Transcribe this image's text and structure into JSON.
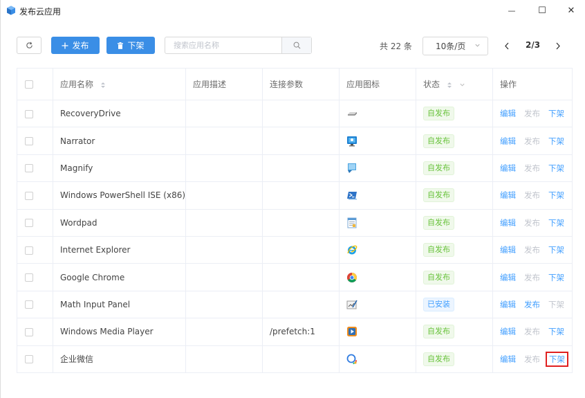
{
  "window": {
    "title": "发布云应用",
    "minimize_glyph": "—",
    "maximize_glyph": "☐",
    "close_glyph": "✕"
  },
  "toolbar": {
    "publish_label": "发布",
    "unpublish_label": "下架",
    "search_placeholder": "搜索应用名称",
    "total_text": "共 22 条",
    "page_size": "10条/页",
    "page_info": "2/3"
  },
  "table": {
    "headers": {
      "name": "应用名称",
      "desc": "应用描述",
      "params": "连接参数",
      "icon": "应用图标",
      "status": "状态",
      "ops": "操作"
    },
    "rows": [
      {
        "name": "RecoveryDrive",
        "desc": "",
        "params": "",
        "icon": "drive-icon",
        "status": "自发布",
        "status_type": "green",
        "edit": "编辑",
        "publish": "发布",
        "publish_enabled": false,
        "unpublish": "下架",
        "unpublish_enabled": true
      },
      {
        "name": "Narrator",
        "desc": "",
        "params": "",
        "icon": "narrator-icon",
        "status": "自发布",
        "status_type": "green",
        "edit": "编辑",
        "publish": "发布",
        "publish_enabled": false,
        "unpublish": "下架",
        "unpublish_enabled": true
      },
      {
        "name": "Magnify",
        "desc": "",
        "params": "",
        "icon": "magnify-icon",
        "status": "自发布",
        "status_type": "green",
        "edit": "编辑",
        "publish": "发布",
        "publish_enabled": false,
        "unpublish": "下架",
        "unpublish_enabled": true
      },
      {
        "name": "Windows PowerShell ISE (x86)",
        "desc": "",
        "params": "",
        "icon": "powershell-icon",
        "status": "自发布",
        "status_type": "green",
        "edit": "编辑",
        "publish": "发布",
        "publish_enabled": false,
        "unpublish": "下架",
        "unpublish_enabled": true
      },
      {
        "name": "Wordpad",
        "desc": "",
        "params": "",
        "icon": "wordpad-icon",
        "status": "自发布",
        "status_type": "green",
        "edit": "编辑",
        "publish": "发布",
        "publish_enabled": false,
        "unpublish": "下架",
        "unpublish_enabled": true
      },
      {
        "name": "Internet Explorer",
        "desc": "",
        "params": "",
        "icon": "internet-explorer-icon",
        "status": "自发布",
        "status_type": "green",
        "edit": "编辑",
        "publish": "发布",
        "publish_enabled": false,
        "unpublish": "下架",
        "unpublish_enabled": true
      },
      {
        "name": "Google Chrome",
        "desc": "",
        "params": "",
        "icon": "chrome-icon",
        "status": "自发布",
        "status_type": "green",
        "edit": "编辑",
        "publish": "发布",
        "publish_enabled": false,
        "unpublish": "下架",
        "unpublish_enabled": true
      },
      {
        "name": "Math Input Panel",
        "desc": "",
        "params": "",
        "icon": "math-input-icon",
        "status": "已安装",
        "status_type": "blue",
        "edit": "编辑",
        "publish": "发布",
        "publish_enabled": true,
        "unpublish": "下架",
        "unpublish_enabled": false
      },
      {
        "name": "Windows Media Player",
        "desc": "",
        "params": "/prefetch:1",
        "icon": "media-player-icon",
        "status": "自发布",
        "status_type": "green",
        "edit": "编辑",
        "publish": "发布",
        "publish_enabled": false,
        "unpublish": "下架",
        "unpublish_enabled": true
      },
      {
        "name": "企业微信",
        "desc": "",
        "params": "",
        "icon": "wecom-icon",
        "status": "自发布",
        "status_type": "green",
        "edit": "编辑",
        "publish": "发布",
        "publish_enabled": false,
        "unpublish": "下架",
        "unpublish_enabled": true,
        "highlight_unpublish": true
      }
    ]
  },
  "colors": {
    "primary": "#3a8ee6",
    "link": "#409eff",
    "success": "#67c23a",
    "disabled": "#c0c4cc",
    "highlight_box": "#e02020"
  }
}
